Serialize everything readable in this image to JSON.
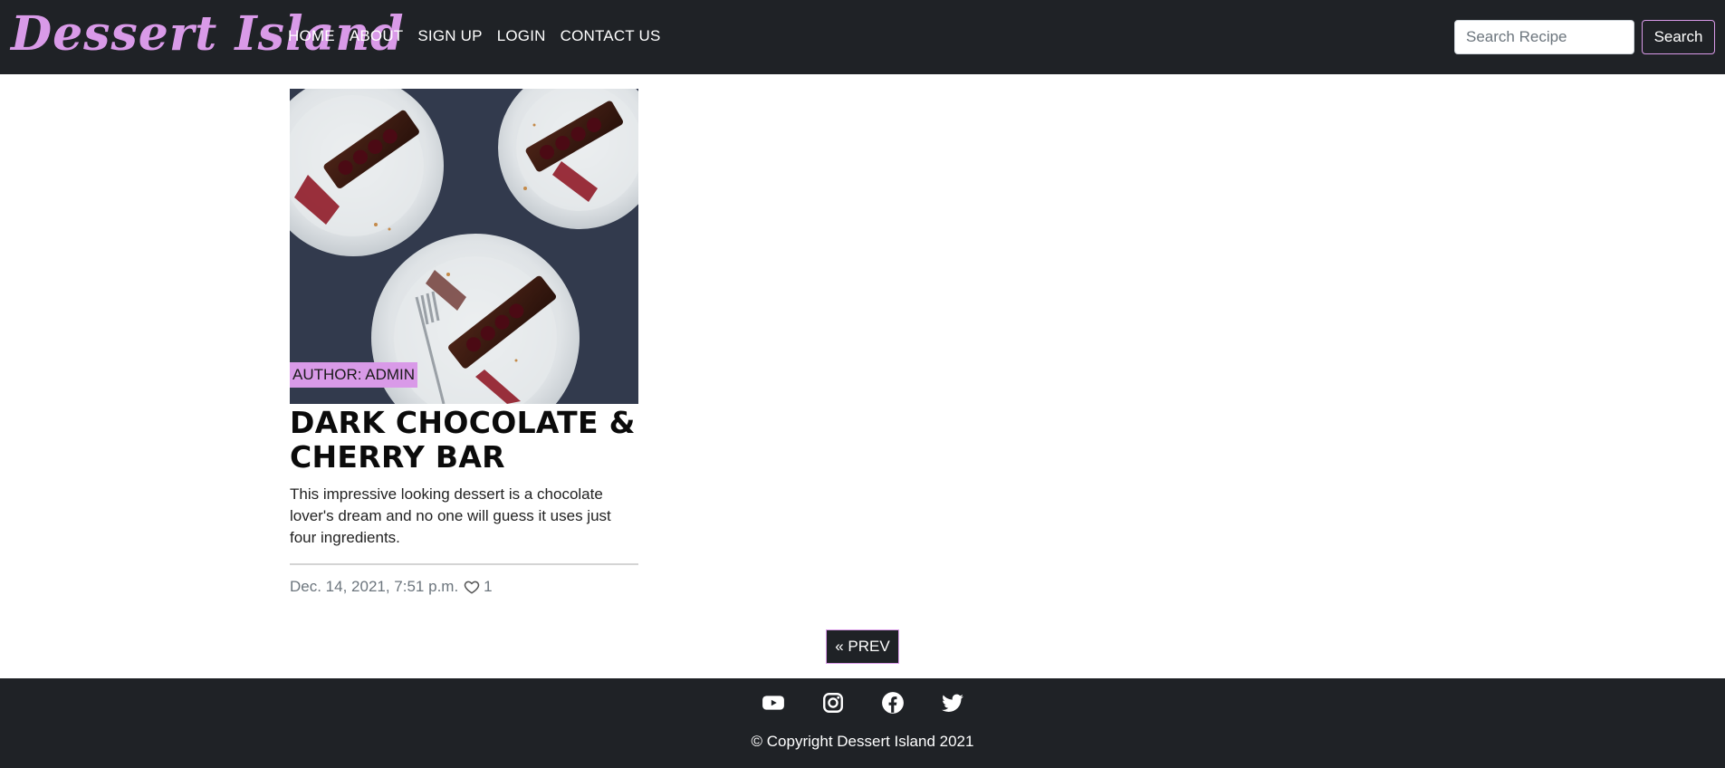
{
  "header": {
    "brand": "Dessert Island",
    "nav": [
      "HOME",
      "ABOUT",
      "SIGN UP",
      "LOGIN",
      "CONTACT US"
    ],
    "search": {
      "placeholder": "Search Recipe",
      "button_label": "Search"
    }
  },
  "recipe_card": {
    "author": "AUTHOR: ADMIN",
    "title": "DARK CHOCOLATE & CHERRY BAR",
    "description": "This impressive looking dessert is a chocolate lover's dream and no one will guess it uses just four ingredients.",
    "date": "Dec. 14, 2021, 7:51 p.m.",
    "likes": "1",
    "image_icon": "dessert-photo"
  },
  "pagination": {
    "prev_label": "« PREV"
  },
  "footer": {
    "icons": [
      "youtube-icon",
      "instagram-icon",
      "facebook-icon",
      "twitter-icon"
    ],
    "copyright": "© Copyright Dessert Island 2021"
  },
  "colors": {
    "nav_bg": "#1f2226",
    "accent": "#d99ae8",
    "white": "#ffffff"
  }
}
